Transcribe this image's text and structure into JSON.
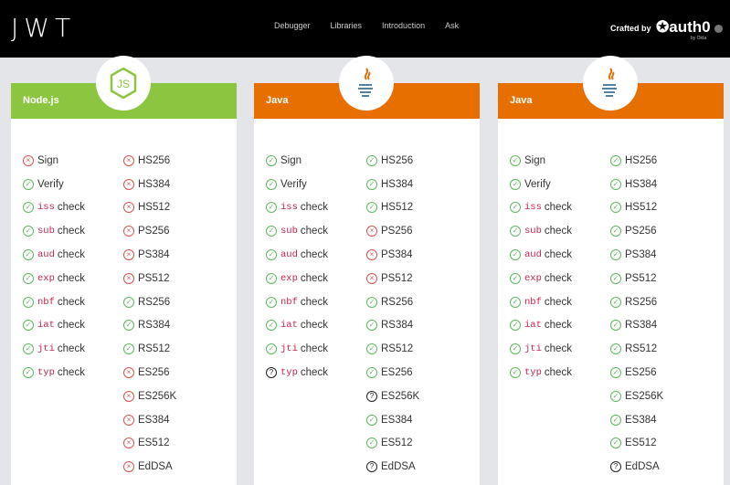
{
  "header": {
    "logo": "JWT",
    "nav": [
      "Debugger",
      "Libraries",
      "Introduction",
      "Ask"
    ],
    "crafted_by": "Crafted by",
    "brand": "auth0",
    "brand_sub": "by Okta"
  },
  "colors": {
    "node": "#8cc540",
    "java": "#e76f00",
    "ok": "#5cb85c",
    "fail": "#d9534f"
  },
  "cards": [
    {
      "title": "Node.js",
      "icon": "nodejs-logo",
      "features": [
        {
          "code": "",
          "label": "Sign",
          "status": "fail"
        },
        {
          "code": "",
          "label": "Verify",
          "status": "ok"
        },
        {
          "code": "iss",
          "label": "check",
          "status": "ok"
        },
        {
          "code": "sub",
          "label": "check",
          "status": "ok"
        },
        {
          "code": "aud",
          "label": "check",
          "status": "ok"
        },
        {
          "code": "exp",
          "label": "check",
          "status": "ok"
        },
        {
          "code": "nbf",
          "label": "check",
          "status": "ok"
        },
        {
          "code": "iat",
          "label": "check",
          "status": "ok"
        },
        {
          "code": "jti",
          "label": "check",
          "status": "ok"
        },
        {
          "code": "typ",
          "label": "check",
          "status": "ok"
        }
      ],
      "algs": [
        {
          "label": "HS256",
          "status": "fail"
        },
        {
          "label": "HS384",
          "status": "fail"
        },
        {
          "label": "HS512",
          "status": "fail"
        },
        {
          "label": "PS256",
          "status": "fail"
        },
        {
          "label": "PS384",
          "status": "fail"
        },
        {
          "label": "PS512",
          "status": "fail"
        },
        {
          "label": "RS256",
          "status": "ok"
        },
        {
          "label": "RS384",
          "status": "ok"
        },
        {
          "label": "RS512",
          "status": "ok"
        },
        {
          "label": "ES256",
          "status": "fail"
        },
        {
          "label": "ES256K",
          "status": "fail"
        },
        {
          "label": "ES384",
          "status": "fail"
        },
        {
          "label": "ES512",
          "status": "fail"
        },
        {
          "label": "EdDSA",
          "status": "fail"
        }
      ]
    },
    {
      "title": "Java",
      "icon": "java-logo",
      "features": [
        {
          "code": "",
          "label": "Sign",
          "status": "ok"
        },
        {
          "code": "",
          "label": "Verify",
          "status": "ok"
        },
        {
          "code": "iss",
          "label": "check",
          "status": "ok"
        },
        {
          "code": "sub",
          "label": "check",
          "status": "ok"
        },
        {
          "code": "aud",
          "label": "check",
          "status": "ok"
        },
        {
          "code": "exp",
          "label": "check",
          "status": "ok"
        },
        {
          "code": "nbf",
          "label": "check",
          "status": "ok"
        },
        {
          "code": "iat",
          "label": "check",
          "status": "ok"
        },
        {
          "code": "jti",
          "label": "check",
          "status": "ok"
        },
        {
          "code": "typ",
          "label": "check",
          "status": "unknown"
        }
      ],
      "algs": [
        {
          "label": "HS256",
          "status": "ok"
        },
        {
          "label": "HS384",
          "status": "ok"
        },
        {
          "label": "HS512",
          "status": "ok"
        },
        {
          "label": "PS256",
          "status": "fail"
        },
        {
          "label": "PS384",
          "status": "fail"
        },
        {
          "label": "PS512",
          "status": "fail"
        },
        {
          "label": "RS256",
          "status": "ok"
        },
        {
          "label": "RS384",
          "status": "ok"
        },
        {
          "label": "RS512",
          "status": "ok"
        },
        {
          "label": "ES256",
          "status": "ok"
        },
        {
          "label": "ES256K",
          "status": "unknown"
        },
        {
          "label": "ES384",
          "status": "ok"
        },
        {
          "label": "ES512",
          "status": "ok"
        },
        {
          "label": "EdDSA",
          "status": "unknown"
        }
      ]
    },
    {
      "title": "Java",
      "icon": "java-logo",
      "features": [
        {
          "code": "",
          "label": "Sign",
          "status": "ok"
        },
        {
          "code": "",
          "label": "Verify",
          "status": "ok"
        },
        {
          "code": "iss",
          "label": "check",
          "status": "ok"
        },
        {
          "code": "sub",
          "label": "check",
          "status": "ok"
        },
        {
          "code": "aud",
          "label": "check",
          "status": "ok"
        },
        {
          "code": "exp",
          "label": "check",
          "status": "ok"
        },
        {
          "code": "nbf",
          "label": "check",
          "status": "ok"
        },
        {
          "code": "iat",
          "label": "check",
          "status": "ok"
        },
        {
          "code": "jti",
          "label": "check",
          "status": "ok"
        },
        {
          "code": "typ",
          "label": "check",
          "status": "ok"
        }
      ],
      "algs": [
        {
          "label": "HS256",
          "status": "ok"
        },
        {
          "label": "HS384",
          "status": "ok"
        },
        {
          "label": "HS512",
          "status": "ok"
        },
        {
          "label": "PS256",
          "status": "ok"
        },
        {
          "label": "PS384",
          "status": "ok"
        },
        {
          "label": "PS512",
          "status": "ok"
        },
        {
          "label": "RS256",
          "status": "ok"
        },
        {
          "label": "RS384",
          "status": "ok"
        },
        {
          "label": "RS512",
          "status": "ok"
        },
        {
          "label": "ES256",
          "status": "ok"
        },
        {
          "label": "ES256K",
          "status": "ok"
        },
        {
          "label": "ES384",
          "status": "ok"
        },
        {
          "label": "ES512",
          "status": "ok"
        },
        {
          "label": "EdDSA",
          "status": "unknown"
        }
      ]
    }
  ]
}
